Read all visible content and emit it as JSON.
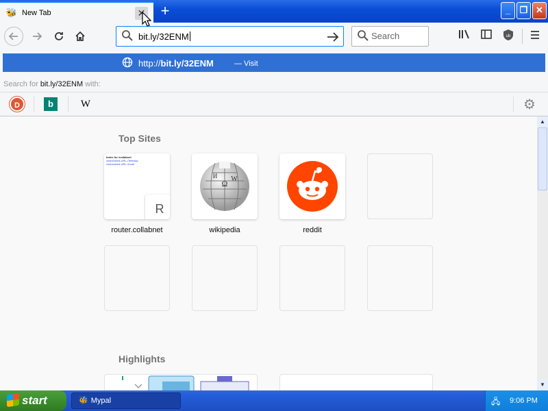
{
  "tab": {
    "title": "New Tab",
    "close_glyph": "✕"
  },
  "window_controls": {
    "minimize": "_",
    "maximize": "❐",
    "close": "✕"
  },
  "nav": {
    "url_value": "bit.ly/32ENM",
    "search_placeholder": "Search"
  },
  "autocomplete": {
    "url_prefix": "http://",
    "url_bold": "bit.ly/32ENM",
    "visit_label": "— Visit",
    "search_for_prefix": "Search for",
    "search_for_query": "bit.ly/32ENM",
    "search_for_suffix": "with:",
    "engines": [
      "DuckDuckGo",
      "Bing",
      "Wikipedia"
    ]
  },
  "newtab": {
    "top_sites_title": "Top Sites",
    "highlights_title": "Highlights",
    "tiles": [
      {
        "label": "router.collabnet",
        "letter": "R",
        "mini_title": "Index for /collabnet",
        "mini_links": [
          "customized-URL-/Teleway",
          "customized-URL-/route"
        ]
      },
      {
        "label": "wikipedia"
      },
      {
        "label": "reddit"
      }
    ]
  },
  "taskbar": {
    "start_label": "start",
    "task_label": "Mypal",
    "clock": "9:06 PM"
  }
}
